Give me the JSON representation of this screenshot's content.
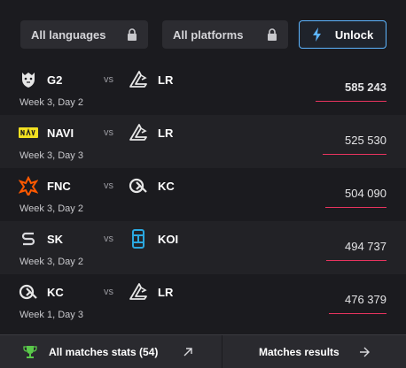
{
  "filters": {
    "languages_label": "All languages",
    "platforms_label": "All platforms",
    "unlock_label": "Unlock"
  },
  "matches": [
    {
      "team1": "G2",
      "team2": "LR",
      "vs": "vs",
      "when": "Week 3, Day 2",
      "views": "585 243",
      "views_fraction": 1.0
    },
    {
      "team1": "NAVI",
      "team2": "LR",
      "vs": "vs",
      "when": "Week 3, Day 3",
      "views": "525 530",
      "views_fraction": 0.9
    },
    {
      "team1": "FNC",
      "team2": "KC",
      "vs": "vs",
      "when": "Week 3, Day 2",
      "views": "504 090",
      "views_fraction": 0.86
    },
    {
      "team1": "SK",
      "team2": "KOI",
      "vs": "vs",
      "when": "Week 3, Day 2",
      "views": "494 737",
      "views_fraction": 0.85
    },
    {
      "team1": "KC",
      "team2": "LR",
      "vs": "vs",
      "when": "Week 1, Day 3",
      "views": "476 379",
      "views_fraction": 0.81
    }
  ],
  "footer": {
    "stats_label": "All matches stats (54)",
    "results_label": "Matches results"
  },
  "colors": {
    "accent_bar": "#e8345f",
    "unlock_border": "#5db5ff",
    "trophy": "#5ac94a"
  },
  "icons": {
    "lock": "lock-icon",
    "unlock": "lightning-icon",
    "trophy": "trophy-icon",
    "arrow_diag": "arrow-up-right-icon",
    "arrow_right": "arrow-right-icon"
  }
}
